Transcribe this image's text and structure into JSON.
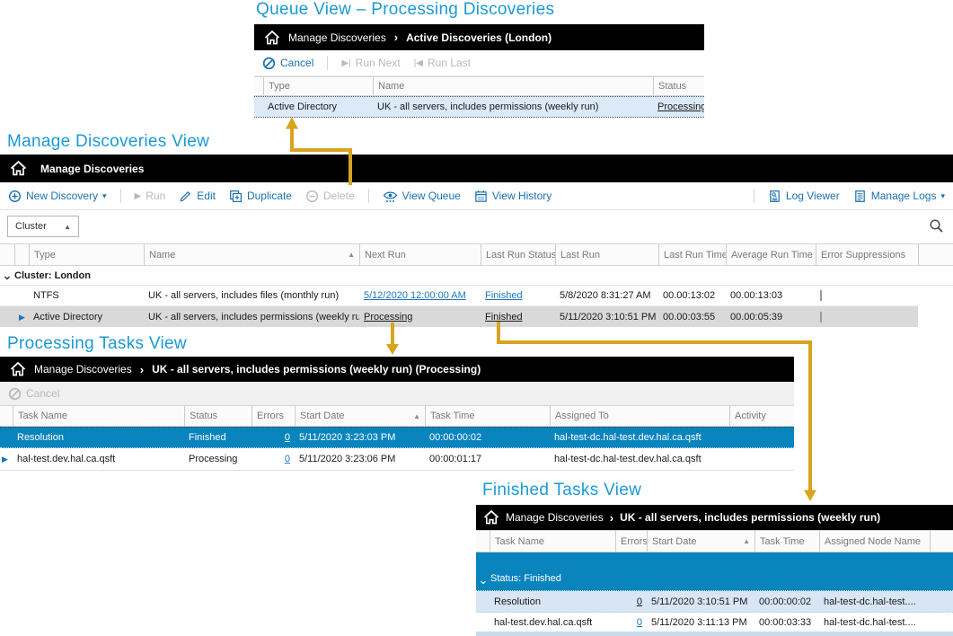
{
  "colors": {
    "title_blue": "#1a9ad6",
    "toolbar_blue": "#1b72ae",
    "link_blue": "#1b75bc",
    "selected_row_blue": "#0a84bd",
    "selected_row_gray": "#d9d9d9",
    "queue_row_blue": "#dbe9f8",
    "arrow_gold": "#d8a41f"
  },
  "icons": {
    "crumb_sep": "›",
    "sort_asc": "▲",
    "caret_down": "▾",
    "chevron_down": "⌄",
    "play": "▶",
    "run_next_glyph": "▶|",
    "run_last_glyph": "|◀",
    "dropdown_up": "▲"
  },
  "queue_view": {
    "section_title": "Queue View – Processing Discoveries",
    "breadcrumb": {
      "root": "Manage Discoveries",
      "current": "Active Discoveries (London)"
    },
    "toolbar": {
      "cancel": "Cancel",
      "run_next": "Run Next",
      "run_last": "Run Last"
    },
    "columns": [
      "Type",
      "Name",
      "Status"
    ],
    "rows": [
      {
        "type": "Active Directory",
        "name": "UK - all servers, includes permissions (weekly run)",
        "status": "Processing"
      }
    ]
  },
  "manage_view": {
    "section_title": "Manage Discoveries View",
    "breadcrumb": {
      "root": "Manage Discoveries"
    },
    "toolbar": {
      "new_discovery": "New Discovery",
      "run": "Run",
      "edit": "Edit",
      "duplicate": "Duplicate",
      "delete": "Delete",
      "view_queue": "View Queue",
      "view_history": "View History",
      "log_viewer": "Log Viewer",
      "manage_logs": "Manage Logs"
    },
    "filter": {
      "group_by": "Cluster"
    },
    "columns": [
      "Type",
      "Name",
      "Next Run",
      "Last Run Status",
      "Last Run",
      "Last Run Time",
      "Average Run Time",
      "Error Suppressions"
    ],
    "group_label": "Cluster: London",
    "rows": [
      {
        "type": "NTFS",
        "name": "UK - all servers, includes files (monthly run)",
        "next_run": "5/12/2020 12:00:00 AM",
        "last_run_status": "Finished",
        "last_run": "5/8/2020 8:31:27 AM",
        "last_run_time": "00.00:13:02",
        "avg_run_time": "00.00:13:03"
      },
      {
        "type": "Active Directory",
        "name": "UK - all servers, includes permissions (weekly run)",
        "next_run": "Processing",
        "last_run_status": "Finished",
        "last_run": "5/11/2020 3:10:51 PM",
        "last_run_time": "00.00:03:55",
        "avg_run_time": "00.00:05:39"
      }
    ]
  },
  "processing_view": {
    "section_title": "Processing Tasks View",
    "breadcrumb": {
      "root": "Manage Discoveries",
      "current": "UK - all servers, includes permissions (weekly run) (Processing)"
    },
    "toolbar": {
      "cancel": "Cancel"
    },
    "columns": [
      "Task Name",
      "Status",
      "Errors",
      "Start Date",
      "Task Time",
      "Assigned To",
      "Activity"
    ],
    "rows": [
      {
        "task_name": "Resolution",
        "status": "Finished",
        "errors": "0",
        "start_date": "5/11/2020 3:23:03 PM",
        "task_time": "00:00:00:02",
        "assigned_to": "hal-test-dc.hal-test.dev.hal.ca.qsft",
        "activity": ""
      },
      {
        "task_name": "hal-test.dev.hal.ca.qsft",
        "status": "Processing",
        "errors": "0",
        "start_date": "5/11/2020 3:23:06 PM",
        "task_time": "00:00:01:17",
        "assigned_to": "hal-test-dc.hal-test.dev.hal.ca.qsft",
        "activity": ""
      }
    ]
  },
  "finished_view": {
    "section_title": "Finished Tasks View",
    "breadcrumb": {
      "root": "Manage Discoveries",
      "current": "UK - all servers, includes permissions (weekly run)"
    },
    "columns": [
      "Task Name",
      "Errors",
      "Start Date",
      "Task Time",
      "Assigned Node Name"
    ],
    "group_label": "Status: Finished",
    "rows": [
      {
        "task_name": "Resolution",
        "errors": "0",
        "start_date": "5/11/2020 3:10:51 PM",
        "task_time": "00:00:00:02",
        "assigned_node": "hal-test-dc.hal-test...."
      },
      {
        "task_name": "hal-test.dev.hal.ca.qsft",
        "errors": "0",
        "start_date": "5/11/2020 3:11:13 PM",
        "task_time": "00:00:03:33",
        "assigned_node": "hal-test-dc.hal-test...."
      }
    ]
  }
}
